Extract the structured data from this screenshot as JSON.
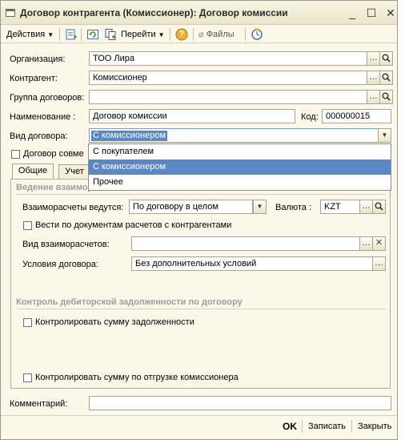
{
  "window": {
    "title": "Договор контрагента (Комиссионер): Договор комиссии",
    "controls": {
      "minimize": "_",
      "maximize": "☐",
      "close": "✕"
    }
  },
  "toolbar": {
    "actions_label": "Действия",
    "goto_label": "Перейти",
    "files_label": "Файлы",
    "help_label": "?"
  },
  "form": {
    "organization": {
      "label": "Организация:",
      "value": "ТОО Лира"
    },
    "counterparty": {
      "label": "Контрагент:",
      "value": "Комиссионер"
    },
    "contract_group": {
      "label": "Группа договоров:",
      "value": ""
    },
    "name": {
      "label": "Наименование :",
      "value": "Договор комиссии"
    },
    "code": {
      "label": "Код:",
      "value": "000000015"
    },
    "contract_type": {
      "label": "Вид договора:",
      "value": "С комиссионером",
      "options": [
        "С покупателем",
        "С комиссионером",
        "Прочее"
      ]
    },
    "joint_checkbox_label": "Договор совме"
  },
  "tabs": [
    {
      "label": "Общие"
    },
    {
      "label": "Учет"
    }
  ],
  "general": {
    "settlements_section": "Ведение взаиморасчетов",
    "settlements_by": {
      "label": "Взаиморасчеты ведутся:",
      "value": "По договору в целом"
    },
    "currency": {
      "label": "Валюта :",
      "value": "KZT"
    },
    "by_docs_label": "Вести по документам расчетов с контрагентами",
    "settlement_type": {
      "label": "Вид взаиморасчетов:",
      "value": ""
    },
    "terms": {
      "label": "Условия договора:",
      "value": "Без дополнительных условий"
    },
    "receivables_section": "Контроль дебиторской задолженности по договору",
    "control_debt_label": "Контролировать сумму задолженности",
    "control_shipment_label": "Контролировать сумму по отгрузке комиссионера"
  },
  "comment": {
    "label": "Комментарий:",
    "value": ""
  },
  "buttons": {
    "ok": "OK",
    "save": "Записать",
    "close": "Закрыть"
  },
  "icons": {
    "toolbar": [
      "doc-list-icon",
      "refresh-icon",
      "copy-icon",
      "help-icon",
      "paperclip-icon",
      "history-icon"
    ],
    "field_buttons": [
      "ellipsis-icon",
      "magnifier-icon",
      "clear-x-icon",
      "dropdown-arrow-icon"
    ]
  }
}
